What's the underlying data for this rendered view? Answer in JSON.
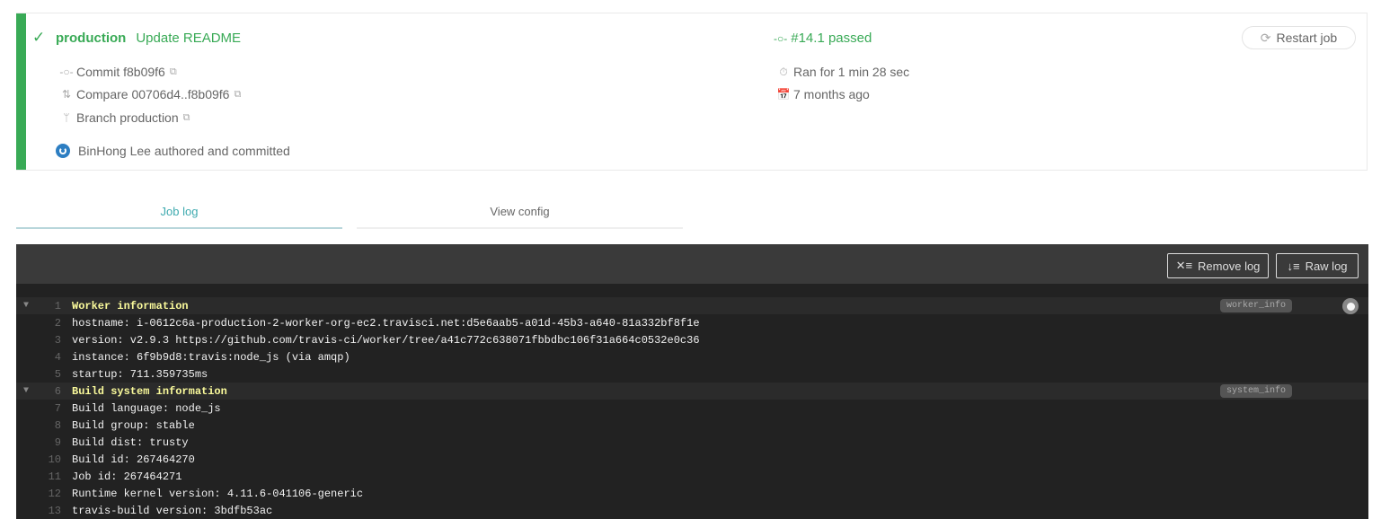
{
  "summary": {
    "status_color": "#39aa56",
    "check_icon": "✓",
    "branch": "production",
    "commit_message": "Update README",
    "commit_label": "Commit f8b09f6",
    "compare_label": "Compare 00706d4..f8b09f6",
    "branch_label": "Branch production",
    "author_text": "BinHong Lee authored and committed",
    "job_status": "#14.1 passed",
    "duration": "Ran for 1 min 28 sec",
    "finished": "7 months ago",
    "restart_label": "Restart job"
  },
  "tabs": [
    {
      "label": "Job log",
      "active": true
    },
    {
      "label": "View config",
      "active": false
    }
  ],
  "log_toolbar": {
    "remove_label": "Remove log",
    "raw_label": "Raw log"
  },
  "log": {
    "lines": [
      {
        "n": "1",
        "text": "Worker information",
        "fold": true,
        "tag": "worker_info"
      },
      {
        "n": "2",
        "text": "hostname: i-0612c6a-production-2-worker-org-ec2.travisci.net:d5e6aab5-a01d-45b3-a640-81a332bf8f1e"
      },
      {
        "n": "3",
        "text": "version: v2.9.3 https://github.com/travis-ci/worker/tree/a41c772c638071fbbdbc106f31a664c0532e0c36"
      },
      {
        "n": "4",
        "text": "instance: 6f9b9d8:travis:node_js (via amqp)"
      },
      {
        "n": "5",
        "text": "startup: 711.359735ms"
      },
      {
        "n": "6",
        "text": "Build system information",
        "fold": true,
        "tag": "system_info"
      },
      {
        "n": "7",
        "text": "Build language: node_js"
      },
      {
        "n": "8",
        "text": "Build group: stable"
      },
      {
        "n": "9",
        "text": "Build dist: trusty"
      },
      {
        "n": "10",
        "text": "Build id: 267464270"
      },
      {
        "n": "11",
        "text": "Job id: 267464271"
      },
      {
        "n": "12",
        "text": "Runtime kernel version: 4.11.6-041106-generic"
      },
      {
        "n": "13",
        "text": "travis-build version: 3bdfb53ac"
      }
    ]
  }
}
